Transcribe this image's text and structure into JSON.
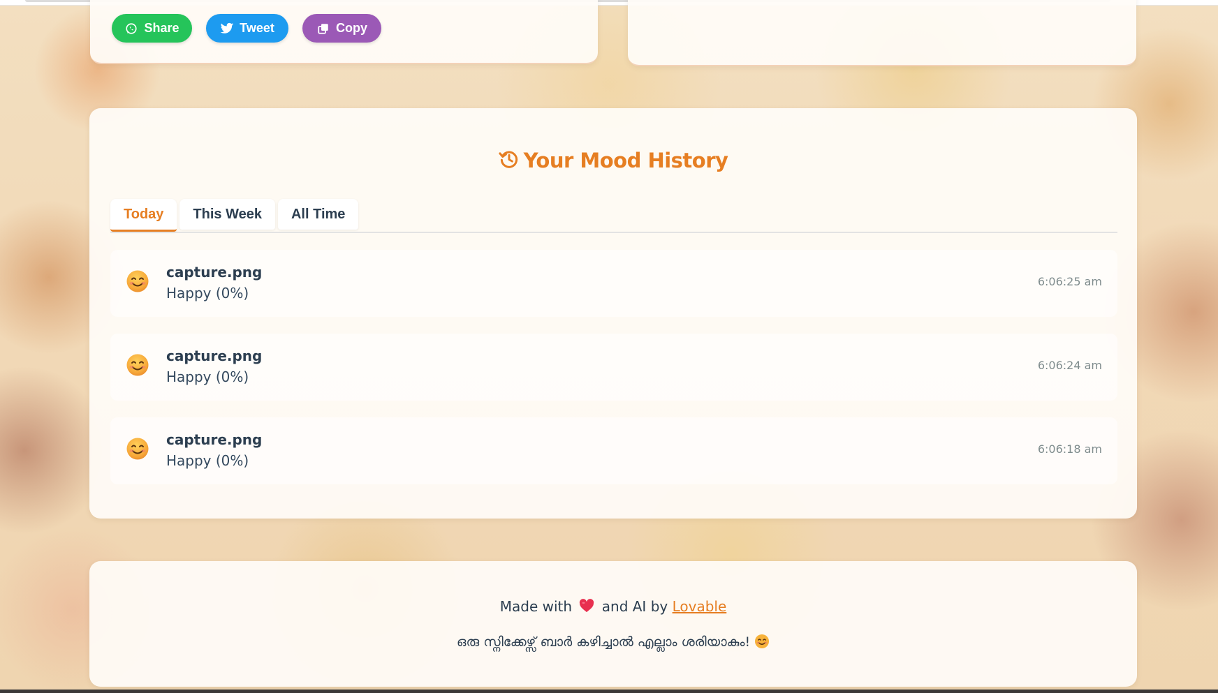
{
  "share": {
    "whatsapp_label": "Share",
    "tweet_label": "Tweet",
    "copy_label": "Copy",
    "whatsapp_color": "#25c45a",
    "tweet_color": "#1d9bf0",
    "copy_color": "#9b59b6"
  },
  "history": {
    "title": "Your Mood History",
    "title_icon": "history-icon",
    "accent_color": "#e67e22",
    "tabs": [
      {
        "label": "Today",
        "active": true
      },
      {
        "label": "This Week",
        "active": false
      },
      {
        "label": "All Time",
        "active": false
      }
    ],
    "entries": [
      {
        "emoji": "smiling-face-icon",
        "file": "capture.png",
        "mood": "Happy (0%)",
        "time": "6:06:25 am"
      },
      {
        "emoji": "smiling-face-icon",
        "file": "capture.png",
        "mood": "Happy (0%)",
        "time": "6:06:24 am"
      },
      {
        "emoji": "smiling-face-icon",
        "file": "capture.png",
        "mood": "Happy (0%)",
        "time": "6:06:18 am"
      }
    ]
  },
  "footer": {
    "made_with": "Made with",
    "and_ai_by": "and AI by",
    "link_text": "Lovable",
    "tagline": "ഒരു സ്നിക്കേഴ്സ് ബാർ കഴിച്ചാൽ എല്ലാം ശരിയാകും!"
  }
}
